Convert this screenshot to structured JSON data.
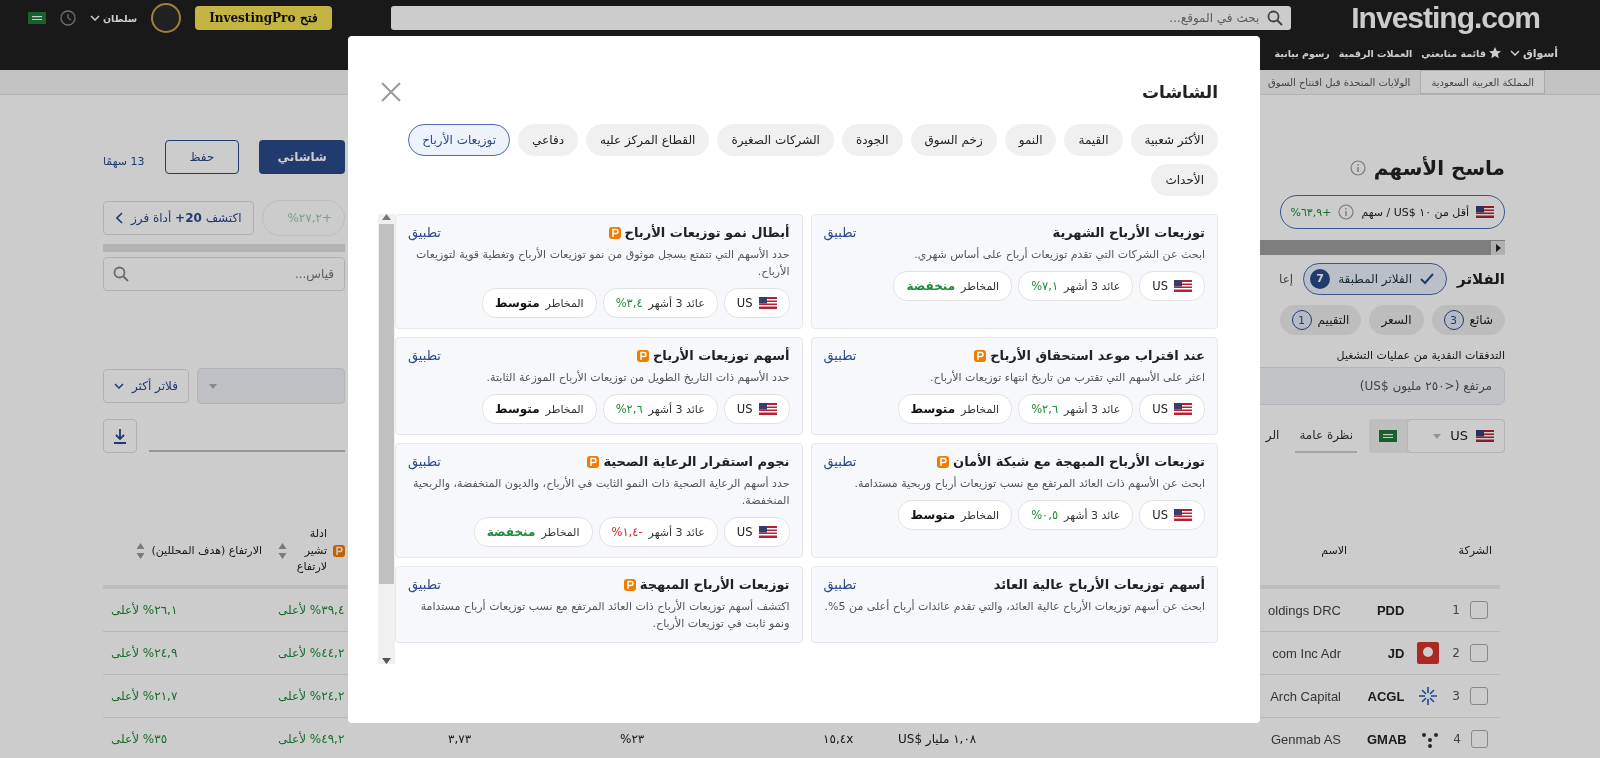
{
  "header": {
    "logo": "Investing.com",
    "search": {
      "placeholder": "بحث في الموقع..."
    },
    "pro_button": "فتح InvestingPro",
    "user": "سلطان"
  },
  "nav": [
    {
      "label": "أسواق",
      "kind": "dropdown"
    },
    {
      "label": "قائمة متابعتي",
      "kind": "star"
    },
    {
      "label": "العملات الرقمية",
      "kind": "plain"
    },
    {
      "label": "رسوم بيانية",
      "kind": "plain"
    }
  ],
  "breadcrumbs": [
    {
      "label": "المملكة العربية السعودية",
      "selected": true
    },
    {
      "label": "الولايات المتحدة قبل افتتاح السوق",
      "selected": false
    }
  ],
  "page": {
    "title": "ماسح الأسهم",
    "featured_chip": {
      "label": "أقل من ١٠ $US / سهم",
      "change": "+٦٣,٩%"
    },
    "filters_label": "الفلاتر",
    "applied_filters": {
      "label": "الفلاتر المطبقة",
      "count": "7"
    },
    "reset_link": "إعا",
    "filter_chips": [
      {
        "label": "شائع",
        "count": "3"
      },
      {
        "label": "السعر"
      },
      {
        "label": "التقييم",
        "count": "1"
      }
    ],
    "field": {
      "label": "التدفقات النقدية من عمليات التشغيل",
      "value": "مرتفع (<٢٥٠ مليون $US)"
    },
    "country": "US",
    "tabs": [
      {
        "label": "نظرة عامة",
        "selected": true
      },
      {
        "label": "الر",
        "selected": false
      }
    ],
    "my_screens_button": "شاشاتي",
    "save_button": "حفظ",
    "result_count": "13 سهمًا",
    "discover_button": "اكتشف **20+** أداة فرز",
    "faded_chip": "+٢٧,٢%",
    "search": {
      "placeholder": "قياس..."
    },
    "more_filters_button": "فلاتر أكثر"
  },
  "table": {
    "columns": {
      "company": "الشركة",
      "name": "الاسم",
      "column_7": "ادلة تشير لارتفاع",
      "analyst_upside": "الارتفاع (هدف المحللين)"
    },
    "rows": [
      {
        "checked": false,
        "number": "1",
        "ticker": "PDD",
        "kind": "plain",
        "name": "oldings DRC",
        "column_7": "٣٩,٤% لأعلى",
        "analyst_upside": "٢٦,١% لأعلى"
      },
      {
        "checked": false,
        "number": "2",
        "ticker": "JD",
        "kind": "square",
        "name": "com Inc Adr",
        "column_7": "٤٤,٢% لأعلى",
        "analyst_upside": "٢٤,٩% لأعلى"
      },
      {
        "checked": false,
        "number": "3",
        "ticker": "ACGL",
        "kind": "burst",
        "name": "Arch Capital",
        "column_7": "٢٤,٢% لأعلى",
        "analyst_upside": "٢١,٧% لأعلى"
      },
      {
        "checked": false,
        "number": "4",
        "ticker": "GMAB",
        "kind": "dots",
        "name": "Genmab AS",
        "market_cap": "١,٠٨ مليار $US",
        "column_4": "١٥,٤x",
        "column_5": "٢٣%",
        "column_6": "٣,٧٣",
        "column_7": "٤٩,٢% لأعلى",
        "analyst_upside": "٣٥% لأعلى"
      }
    ]
  },
  "modal": {
    "title": "الشاشات",
    "categories": [
      {
        "label": "الأكثر شعبية",
        "selected": false
      },
      {
        "label": "القيمة",
        "selected": false
      },
      {
        "label": "النمو",
        "selected": false
      },
      {
        "label": "زخم السوق",
        "selected": false
      },
      {
        "label": "الجودة",
        "selected": false
      },
      {
        "label": "الشركات الصغيرة",
        "selected": false
      },
      {
        "label": "القطاع المركز عليه",
        "selected": false
      },
      {
        "label": "دفاعي",
        "selected": false
      },
      {
        "label": "توزيعات الأرباح",
        "selected": true
      },
      {
        "label": "الأحداث",
        "selected": false
      }
    ],
    "cards": [
      {
        "title": "توزيعات الأرباح الشهرية",
        "pro": false,
        "apply": "تطبيق",
        "description": "ابحث عن الشركات التي تقدم توزيعات أرباح على أساس شهري.",
        "tags": [
          {
            "kind": "country",
            "value": "US"
          },
          {
            "kind": "yield",
            "label": "عائد 3 أشهر",
            "value": "٧,١%",
            "color": "#1f8a3a"
          },
          {
            "kind": "risk",
            "label": "المخاطر",
            "value": "منخفضة",
            "color": "#1f8a3a"
          }
        ]
      },
      {
        "title": "أبطال نمو توزيعات الأرباح",
        "pro": true,
        "apply": "تطبيق",
        "description": "حدد الأسهم التي تتمتع بسجل موثوق من نمو توزيعات الأرباح وتغطية قوية لتوزيعات الأرباح.",
        "tags": [
          {
            "kind": "country",
            "value": "US"
          },
          {
            "kind": "yield",
            "label": "عائد 3 أشهر",
            "value": "٣,٤%",
            "color": "#1f8a3a"
          },
          {
            "kind": "risk",
            "label": "المخاطر",
            "value": "متوسط",
            "color": "#111111"
          }
        ]
      },
      {
        "title": "عند اقتراب موعد استحقاق الأرباح",
        "pro": true,
        "apply": "تطبيق",
        "description": "اعثر على الأسهم التي تقترب من تاريخ انتهاء توزيعات الأرباح.",
        "tags": [
          {
            "kind": "country",
            "value": "US"
          },
          {
            "kind": "yield",
            "label": "عائد 3 أشهر",
            "value": "٢,٦%",
            "color": "#1f8a3a"
          },
          {
            "kind": "risk",
            "label": "المخاطر",
            "value": "متوسط",
            "color": "#111111"
          }
        ]
      },
      {
        "title": "أسهم توزيعات الأرباح",
        "pro": true,
        "apply": "تطبيق",
        "description": "حدد الأسهم ذات التاريخ الطويل من توزيعات الأرباح الموزعة الثابتة.",
        "tags": [
          {
            "kind": "country",
            "value": "US"
          },
          {
            "kind": "yield",
            "label": "عائد 3 أشهر",
            "value": "٢,٦%",
            "color": "#1f8a3a"
          },
          {
            "kind": "risk",
            "label": "المخاطر",
            "value": "متوسط",
            "color": "#111111"
          }
        ]
      },
      {
        "title": "توزيعات الأرباح المبهجة مع شبكة الأمان",
        "pro": true,
        "apply": "تطبيق",
        "description": "ابحث عن الأسهم ذات العائد المرتفع مع نسب توزيعات أرباح وربحية مستدامة.",
        "tags": [
          {
            "kind": "country",
            "value": "US"
          },
          {
            "kind": "yield",
            "label": "عائد 3 أشهر",
            "value": "٠,٥%",
            "color": "#1f8a3a"
          },
          {
            "kind": "risk",
            "label": "المخاطر",
            "value": "متوسط",
            "color": "#111111"
          }
        ]
      },
      {
        "title": "نجوم استقرار الرعاية الصحية",
        "pro": true,
        "apply": "تطبيق",
        "description": "حدد أسهم الرعاية الصحية ذات النمو الثابت في الأرباح، والديون المنخفضة، والربحية المنخفضة.",
        "tags": [
          {
            "kind": "country",
            "value": "US"
          },
          {
            "kind": "yield",
            "label": "عائد 3 أشهر",
            "value": "-١,٤%",
            "color": "#c62828"
          },
          {
            "kind": "risk",
            "label": "المخاطر",
            "value": "منخفضة",
            "color": "#1f8a3a"
          }
        ]
      },
      {
        "title": "أسهم توزيعات الأرباح عالية العائد",
        "pro": false,
        "apply": "تطبيق",
        "description": "ابحث عن أسهم توزيعات الأرباح عالية العائد، والتي تقدم عائدات أرباح أعلى من 5%."
      },
      {
        "title": "توزيعات الأرباح المبهجة",
        "pro": true,
        "apply": "تطبيق",
        "description": "اكتشف أسهم توزيعات الأرباح ذات العائد المرتفع مع نسب توزيعات أرباح مستدامة ونمو ثابت في توزيعات الأرباح."
      }
    ]
  }
}
